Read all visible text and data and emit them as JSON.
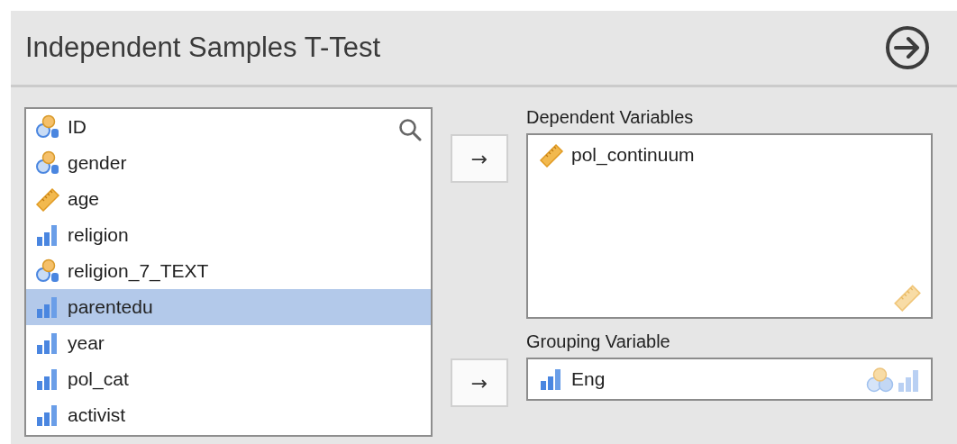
{
  "header": {
    "title": "Independent Samples T-Test"
  },
  "variables": [
    {
      "name": "ID",
      "kind": "nominal",
      "selected": false
    },
    {
      "name": "gender",
      "kind": "nominal",
      "selected": false
    },
    {
      "name": "age",
      "kind": "continuous",
      "selected": false
    },
    {
      "name": "religion",
      "kind": "ordinal",
      "selected": false
    },
    {
      "name": "religion_7_TEXT",
      "kind": "nominal",
      "selected": false
    },
    {
      "name": "parentedu",
      "kind": "ordinal",
      "selected": true
    },
    {
      "name": "year",
      "kind": "ordinal",
      "selected": false
    },
    {
      "name": "pol_cat",
      "kind": "ordinal",
      "selected": false
    },
    {
      "name": "activist",
      "kind": "ordinal",
      "selected": false
    }
  ],
  "targets": [
    {
      "label": "Dependent Variables",
      "button": "→",
      "kind": "multi",
      "allowed": [
        {
          "kind": "continuous"
        }
      ],
      "items": [
        {
          "name": "pol_continuum",
          "kind": "continuous"
        }
      ]
    },
    {
      "label": "Grouping Variable",
      "button": "→",
      "kind": "single",
      "allowed": [
        {
          "kind": "nominal"
        },
        {
          "kind": "ordinal"
        }
      ],
      "items": [
        {
          "name": "Eng",
          "kind": "ordinal"
        }
      ]
    }
  ]
}
